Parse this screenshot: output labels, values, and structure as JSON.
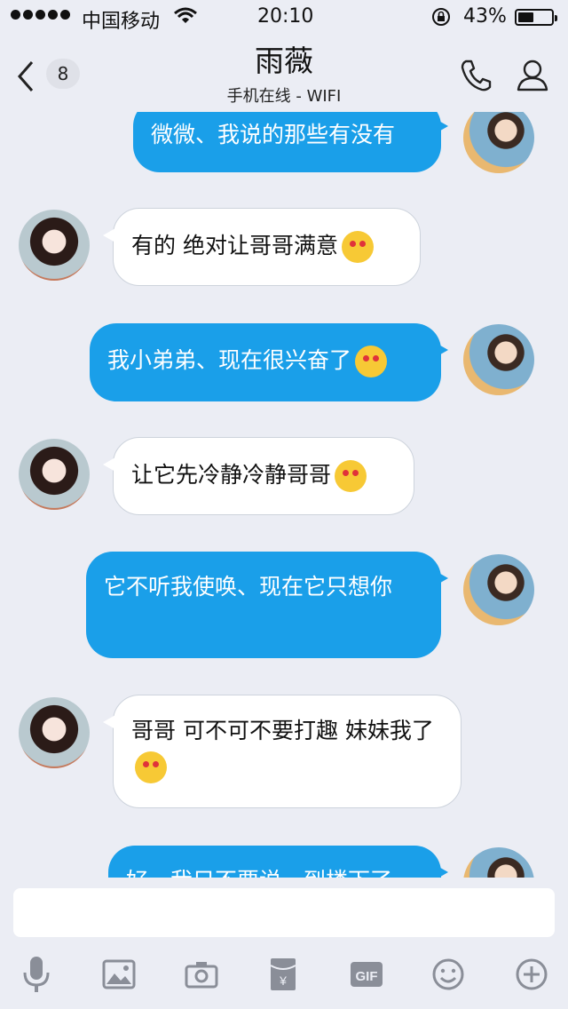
{
  "status": {
    "carrier": "中国移动",
    "time": "20:10",
    "battery": "43%",
    "battery_level": 0.43
  },
  "header": {
    "back_count": "8",
    "title": "雨薇",
    "subtitle": "手机在线 - WIFI"
  },
  "messages": [
    {
      "side": "out",
      "text": "微微、我说的那些有没有"
    },
    {
      "side": "in",
      "text": "有的 绝对让哥哥满意"
    },
    {
      "side": "out",
      "text": "我小弟弟、现在很兴奋了"
    },
    {
      "side": "in",
      "text": "让它先冷静冷静哥哥"
    },
    {
      "side": "out",
      "text": "它不听我使唤、现在它只想你"
    },
    {
      "side": "in",
      "text": "哥哥 可不可不要打趣 妹妹我了"
    },
    {
      "side": "out",
      "text": "好、我只不要说、到楼下了"
    }
  ],
  "input": {
    "placeholder": ""
  },
  "toolbar": [
    "mic-icon",
    "image-icon",
    "camera-icon",
    "red-packet-icon",
    "gif-icon",
    "emoji-icon",
    "plus-icon"
  ]
}
